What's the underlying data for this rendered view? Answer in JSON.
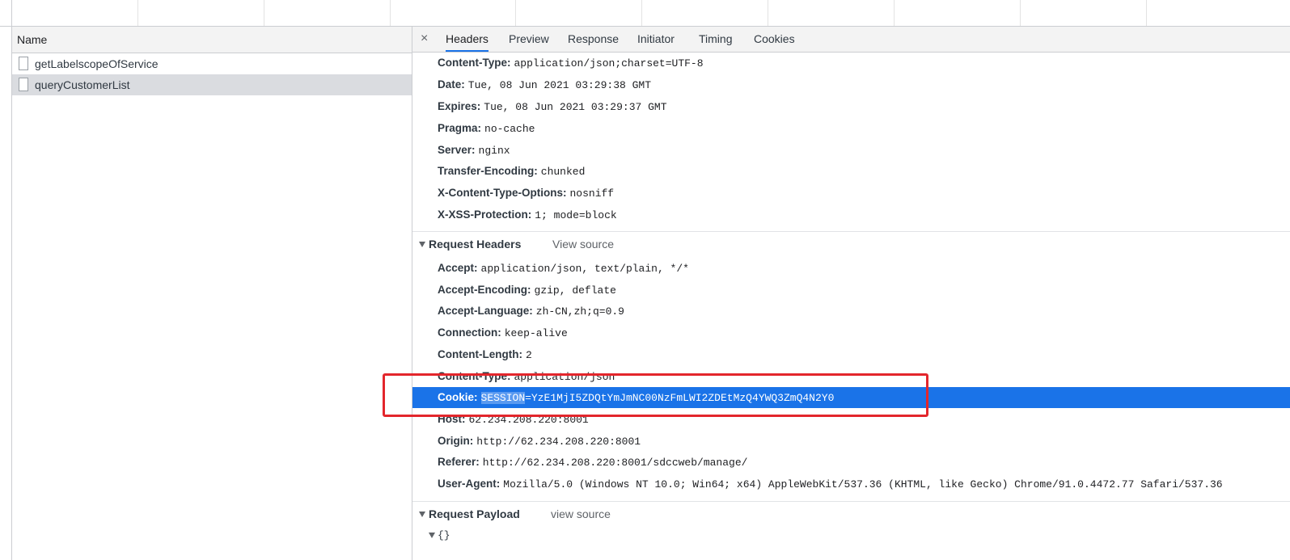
{
  "request_list": {
    "column_header": "Name",
    "items": [
      {
        "name": "getLabelscopeOfService",
        "selected": false
      },
      {
        "name": "queryCustomerList",
        "selected": true
      }
    ]
  },
  "detail": {
    "close_glyph": "×",
    "tabs": [
      {
        "label": "Headers",
        "active": true
      },
      {
        "label": "Preview",
        "active": false
      },
      {
        "label": "Response",
        "active": false
      },
      {
        "label": "Initiator",
        "active": false
      },
      {
        "label": "Timing",
        "active": false
      },
      {
        "label": "Cookies",
        "active": false
      }
    ],
    "response_headers": [
      {
        "key": "Content-Type:",
        "value": "application/json;charset=UTF-8"
      },
      {
        "key": "Date:",
        "value": "Tue, 08 Jun 2021 03:29:38 GMT"
      },
      {
        "key": "Expires:",
        "value": "Tue, 08 Jun 2021 03:29:37 GMT"
      },
      {
        "key": "Pragma:",
        "value": "no-cache"
      },
      {
        "key": "Server:",
        "value": "nginx"
      },
      {
        "key": "Transfer-Encoding:",
        "value": "chunked"
      },
      {
        "key": "X-Content-Type-Options:",
        "value": "nosniff"
      },
      {
        "key": "X-XSS-Protection:",
        "value": "1; mode=block"
      }
    ],
    "request_headers_section": {
      "title": "Request Headers",
      "view_source": "View source"
    },
    "request_headers": [
      {
        "key": "Accept:",
        "value": "application/json, text/plain, */*"
      },
      {
        "key": "Accept-Encoding:",
        "value": "gzip, deflate"
      },
      {
        "key": "Accept-Language:",
        "value": "zh-CN,zh;q=0.9"
      },
      {
        "key": "Connection:",
        "value": "keep-alive"
      },
      {
        "key": "Content-Length:",
        "value": "2"
      },
      {
        "key": "Content-Type:",
        "value": "application/json"
      },
      {
        "key": "Cookie:",
        "value_selected_part": "SESSION",
        "value_rest": "=YzE1MjI5ZDQtYmJmNC00NzFmLWI2ZDEtMzQ4YWQ3ZmQ4N2Y0",
        "selected": true
      },
      {
        "key": "Host:",
        "value": "62.234.208.220:8001"
      },
      {
        "key": "Origin:",
        "value": "http://62.234.208.220:8001"
      },
      {
        "key": "Referer:",
        "value": "http://62.234.208.220:8001/sdccweb/manage/"
      },
      {
        "key": "User-Agent:",
        "value": "Mozilla/5.0 (Windows NT 10.0; Win64; x64) AppleWebKit/537.36 (KHTML, like Gecko) Chrome/91.0.4472.77 Safari/537.36"
      }
    ],
    "request_payload_section": {
      "title": "Request Payload",
      "view_source": "view source"
    },
    "payload_value": "{}"
  },
  "colors": {
    "selection_blue": "#1a73e8",
    "annotation_red": "#e3262c",
    "selected_row_gray": "#dadce0"
  }
}
